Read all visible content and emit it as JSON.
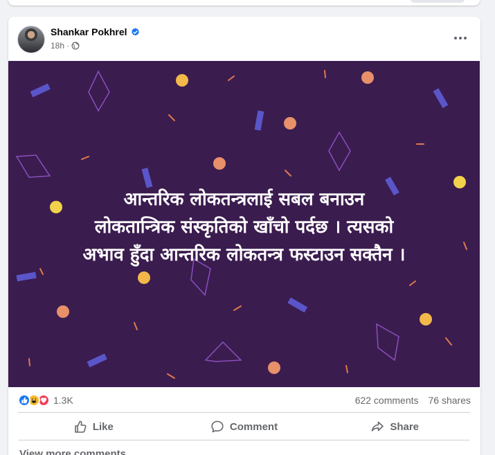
{
  "post": {
    "author": "Shankar Pokhrel",
    "timestamp": "18h",
    "separator": "·",
    "text_lines": [
      "आन्तरिक लोकतन्त्रलाई सबल बनाउन",
      "लोकतान्त्रिक संस्कृतिको खाँचो पर्दछ । त्यसको",
      "अभाव हुँदा आन्तरिक लोकतन्त्र फस्टाउन सक्तैन ।"
    ],
    "background_color": "#3b1c4f",
    "icons": [
      "verified-badge-icon",
      "globe-icon",
      "more-options-icon"
    ]
  },
  "stats": {
    "reaction_count": "1.3K",
    "reactions": [
      "like",
      "haha",
      "love"
    ],
    "comments": "622 comments",
    "shares": "76 shares"
  },
  "actions": {
    "like": "Like",
    "comment": "Comment",
    "share": "Share"
  },
  "footer": {
    "view_more": "View more comments"
  },
  "colors": {
    "accent": "#1877f2",
    "like": "#1877f2",
    "haha": "#f7b928",
    "love": "#f33e58"
  }
}
